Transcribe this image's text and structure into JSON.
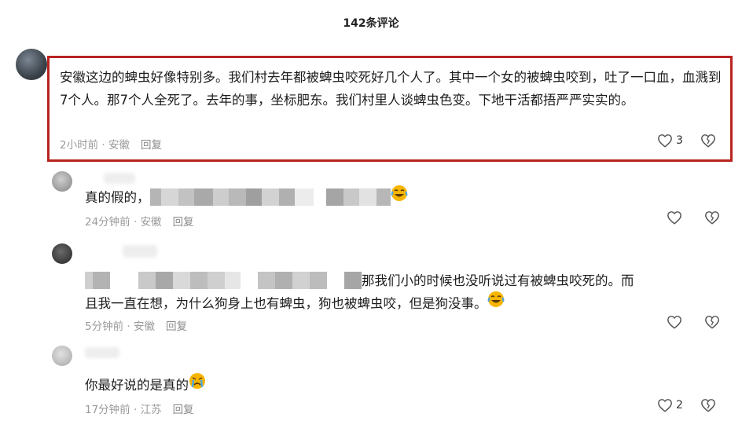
{
  "header": {
    "title": "142条评论"
  },
  "comments": [
    {
      "text": "安徽这边的蜱虫好像特别多。我们村去年都被蜱虫咬死好几个人了。其中一个女的被蜱虫咬到，吐了一口血，血溅到7个人。那7个人全死了。去年的事，坐标肥东。我们村里人谈蜱虫色变。下地干活都捂严严实实的。",
      "time": "2小时前",
      "location": "安徽",
      "reply": "回复",
      "likes": "3",
      "highlighted": true
    },
    {
      "text": "真的假的，",
      "time": "24分钟前",
      "location": "安徽",
      "reply": "回复",
      "likes": "",
      "emoji": "crying-laughing-emoji"
    },
    {
      "text_part1": "那我们小的时候也没听说过有被蜱虫咬死的。而",
      "text_part2": "且我一直在想，为什么狗身上也有蜱虫，狗也被蜱虫咬，但是狗没事。",
      "time": "5分钟前",
      "location": "安徽",
      "reply": "回复",
      "likes": "",
      "emoji": "crying-laughing-emoji"
    },
    {
      "text": "你最好说的是真的",
      "time": "17分钟前",
      "location": "江苏",
      "reply": "回复",
      "likes": "2",
      "emoji": "crying-emoji"
    }
  ],
  "separator": " · ",
  "colors": {
    "highlight_border": "#b9231f",
    "meta_text": "#9a9a9a",
    "emoji_yellow": "#f7b500"
  }
}
